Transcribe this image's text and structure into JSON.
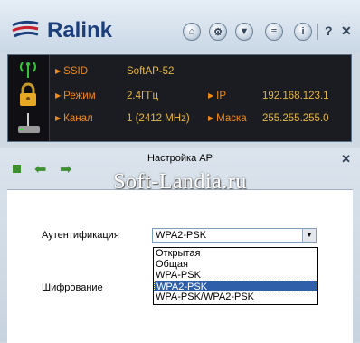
{
  "header": {
    "brand": "Ralink",
    "toolbar": [
      {
        "name": "site-survey-icon"
      },
      {
        "name": "settings-gear-icon"
      },
      {
        "name": "filter-icon"
      },
      {
        "name": "log-list-icon"
      },
      {
        "name": "info-icon"
      }
    ],
    "help_label": "?",
    "close_label": "✕"
  },
  "status": {
    "ssid_label": "SSID",
    "ssid_value": "SoftAP-52",
    "mode_label": "Режим",
    "mode_value": "2.4ГГц",
    "channel_label": "Канал",
    "channel_value": "1 (2412 MHz)",
    "ip_label": "IP",
    "ip_value": "192.168.123.1",
    "mask_label": "Маска",
    "mask_value": "255.255.255.0"
  },
  "ap": {
    "title": "Настройка AP",
    "close_label": "✕",
    "auth_label": "Аутентификация",
    "auth_selected": "WPA2-PSK",
    "auth_options": [
      "Открытая",
      "Общая",
      "WPA-PSK",
      "WPA2-PSK",
      "WPA-PSK/WPA2-PSK"
    ],
    "encryption_label": "Шифрование"
  },
  "watermark": "Soft-Landia.ru"
}
